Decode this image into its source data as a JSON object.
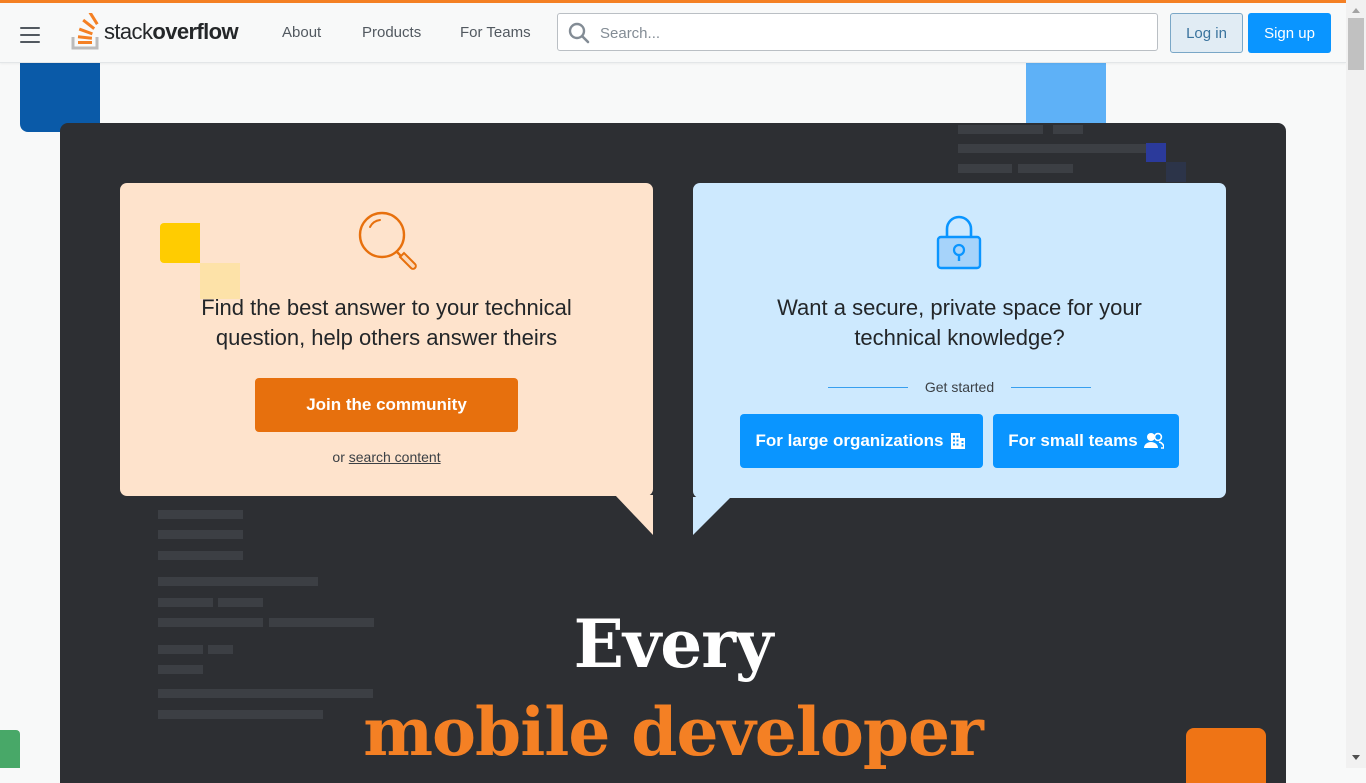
{
  "brand": {
    "name_light": "stack",
    "name_bold": "overflow"
  },
  "nav": {
    "about": "About",
    "products": "Products",
    "for_teams": "For Teams"
  },
  "search": {
    "placeholder": "Search..."
  },
  "auth": {
    "login": "Log in",
    "signup": "Sign up"
  },
  "community_card": {
    "line1": "Find the best answer to your technical",
    "line2": "question, help others answer theirs",
    "cta": "Join the community",
    "or": "or",
    "search_link": "search content"
  },
  "teams_card": {
    "line1": "Want a secure, private space for your",
    "line2": "technical knowledge?",
    "get_started": "Get started",
    "large_orgs": "For large organizations",
    "small_teams": "For small teams"
  },
  "hero": {
    "line1": "Every",
    "line2": "mobile developer"
  },
  "icons": [
    "menu-icon",
    "stack-overflow-logo-icon",
    "search-icon",
    "magnifier-icon",
    "padlock-icon",
    "building-icon",
    "users-icon"
  ],
  "colors": {
    "accent": "#f48024",
    "primary": "#0a95ff",
    "hero_bg": "#2d2f33"
  }
}
